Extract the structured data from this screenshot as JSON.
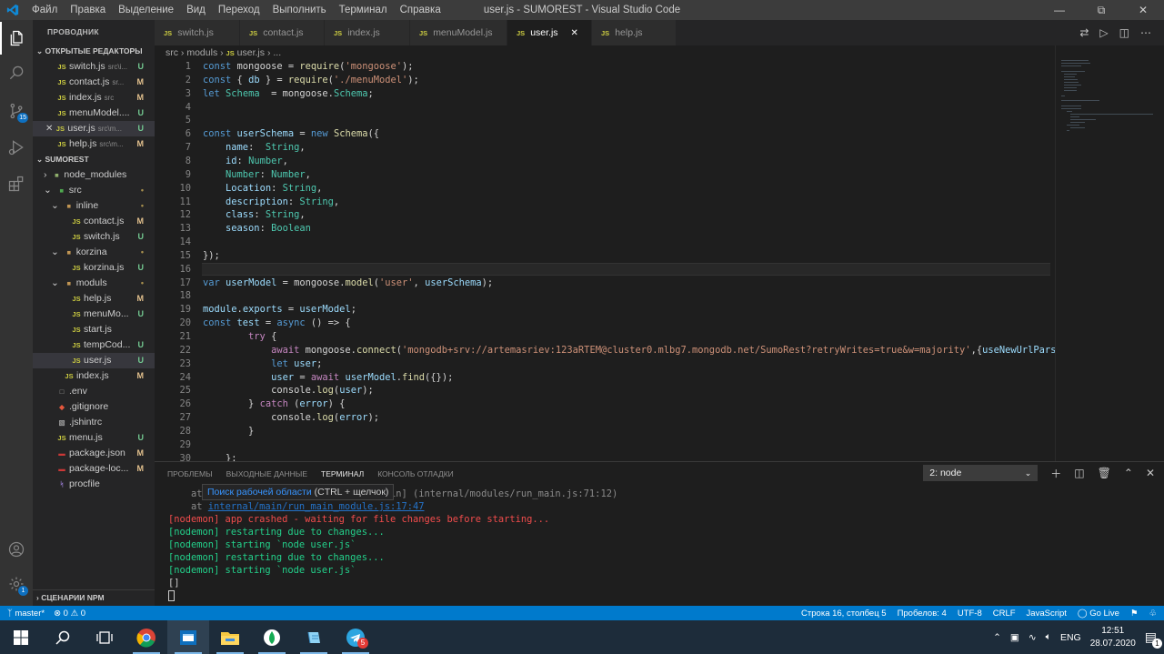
{
  "window": {
    "title": "user.js - SUMOREST - Visual Studio Code",
    "menu": [
      "Файл",
      "Правка",
      "Выделение",
      "Вид",
      "Переход",
      "Выполнить",
      "Терминал",
      "Справка"
    ]
  },
  "activity": {
    "scm_badge": "15",
    "settings_badge": "1"
  },
  "sidebar": {
    "header": "ПРОВОДНИК",
    "open_editors_title": "ОТКРЫТЫЕ РЕДАКТОРЫ",
    "open_editors": [
      {
        "name": "switch.js",
        "desc": "src\\i...",
        "status": "U"
      },
      {
        "name": "contact.js",
        "desc": "sr...",
        "status": "M"
      },
      {
        "name": "index.js",
        "desc": "src",
        "status": "M"
      },
      {
        "name": "menuModel....",
        "desc": "",
        "status": "U"
      },
      {
        "name": "user.js",
        "desc": "src\\m...",
        "status": "U"
      },
      {
        "name": "help.js",
        "desc": "src\\m...",
        "status": "M"
      }
    ],
    "project_title": "SUMOREST",
    "tree": [
      {
        "name": "node_modules",
        "status": ""
      },
      {
        "name": "src",
        "status": "•"
      },
      {
        "name": "inline",
        "status": "•"
      },
      {
        "name": "contact.js",
        "status": "M"
      },
      {
        "name": "switch.js",
        "status": "U"
      },
      {
        "name": "korzina",
        "status": "•"
      },
      {
        "name": "korzina.js",
        "status": "U"
      },
      {
        "name": "moduls",
        "status": "•"
      },
      {
        "name": "help.js",
        "status": "M"
      },
      {
        "name": "menuMo...",
        "status": "U"
      },
      {
        "name": "start.js",
        "status": ""
      },
      {
        "name": "tempCod...",
        "status": "U"
      },
      {
        "name": "user.js",
        "status": "U"
      },
      {
        "name": "index.js",
        "status": "M"
      },
      {
        "name": ".env",
        "status": ""
      },
      {
        "name": ".gitignore",
        "status": ""
      },
      {
        "name": ".jshintrc",
        "status": ""
      },
      {
        "name": "menu.js",
        "status": "U"
      },
      {
        "name": "package.json",
        "status": "M"
      },
      {
        "name": "package-loc...",
        "status": "M"
      },
      {
        "name": "procfile",
        "status": ""
      }
    ],
    "npm_title": "СЦЕНАРИИ NPM"
  },
  "tabs": [
    "switch.js",
    "contact.js",
    "index.js",
    "menuModel.js",
    "user.js",
    "help.js"
  ],
  "breadcrumb": [
    "src",
    "moduls",
    "user.js",
    "..."
  ],
  "editor": {
    "line_numbers": [
      "1",
      "2",
      "3",
      "4",
      "5",
      "6",
      "7",
      "8",
      "9",
      "10",
      "11",
      "12",
      "13",
      "14",
      "15",
      "16",
      "17",
      "18",
      "19",
      "20",
      "21",
      "22",
      "23",
      "24",
      "25",
      "26",
      "27",
      "28",
      "29",
      "30"
    ],
    "code": [
      "const mongoose = require('mongoose');",
      "const { db } = require('./menuModel');",
      "let Schema  = mongoose.Schema;",
      "",
      "",
      "const userSchema = new Schema({",
      "    name:  String,",
      "    id: Number,",
      "    Number: Number,",
      "    Location: String,",
      "    description: String,",
      "    class: String,",
      "    season: Boolean",
      "",
      "});",
      "",
      "var userModel = mongoose.model('user', userSchema);",
      "",
      "module.exports = userModel;",
      "const test = async () => {",
      "        try {",
      "            await mongoose.connect('mongodb+srv://artemasriev:123aRTEM@cluster0.mlbg7.mongodb.net/SumoRest?retryWrites=true&w=majority',{useNewUrlParser : t",
      "            let user;",
      "            user = await userModel.find({});",
      "            console.log(user);",
      "        } catch (error) {",
      "            console.log(error);",
      "        }",
      "",
      "    };"
    ]
  },
  "panel": {
    "tabs": [
      "ПРОБЛЕМЫ",
      "ВЫХОДНЫЕ ДАННЫЕ",
      "ТЕРМИНАЛ",
      "КОНСОЛЬ ОТЛАДКИ"
    ],
    "terminal_selected": "2: node",
    "tooltip_link": "Поиск рабочей области",
    "tooltip_hint": "(CTRL + щелчок)",
    "lines": [
      {
        "a": "    at ",
        "b": "",
        "c": "                              main] (internal/modules/run_main.js:71:12)",
        "cls": "dim"
      },
      {
        "a": "    at ",
        "b": "internal/main/run_main_module.js:17:47",
        "c": "",
        "cls": "dim"
      },
      {
        "a": "[nodemon] app crashed - waiting for file changes before starting...",
        "b": "",
        "c": "",
        "cls": "red"
      },
      {
        "a": "[nodemon] restarting due to changes...",
        "b": "",
        "c": "",
        "cls": "grn"
      },
      {
        "a": "[nodemon] starting `node user.js`",
        "b": "",
        "c": "",
        "cls": "grn"
      },
      {
        "a": "[nodemon] restarting due to changes...",
        "b": "",
        "c": "",
        "cls": "grn"
      },
      {
        "a": "[nodemon] starting `node user.js`",
        "b": "",
        "c": "",
        "cls": "grn"
      },
      {
        "a": "[]",
        "b": "",
        "c": "",
        "cls": ""
      }
    ]
  },
  "status": {
    "branch": "master*",
    "problems": "⊗ 0 ⚠ 0",
    "position": "Строка 16, столбец 5",
    "spaces": "Пробелов: 4",
    "encoding": "UTF-8",
    "eol": "CRLF",
    "language": "JavaScript",
    "golive": "Go Live"
  },
  "taskbar": {
    "lang": "ENG",
    "time": "12:51",
    "date": "28.07.2020",
    "telegram_badge": "5",
    "notif_badge": "1"
  },
  "colors": {
    "accent": "#007acc",
    "keyword": "#569cd6",
    "string": "#ce9178",
    "function": "#dcdcaa"
  }
}
